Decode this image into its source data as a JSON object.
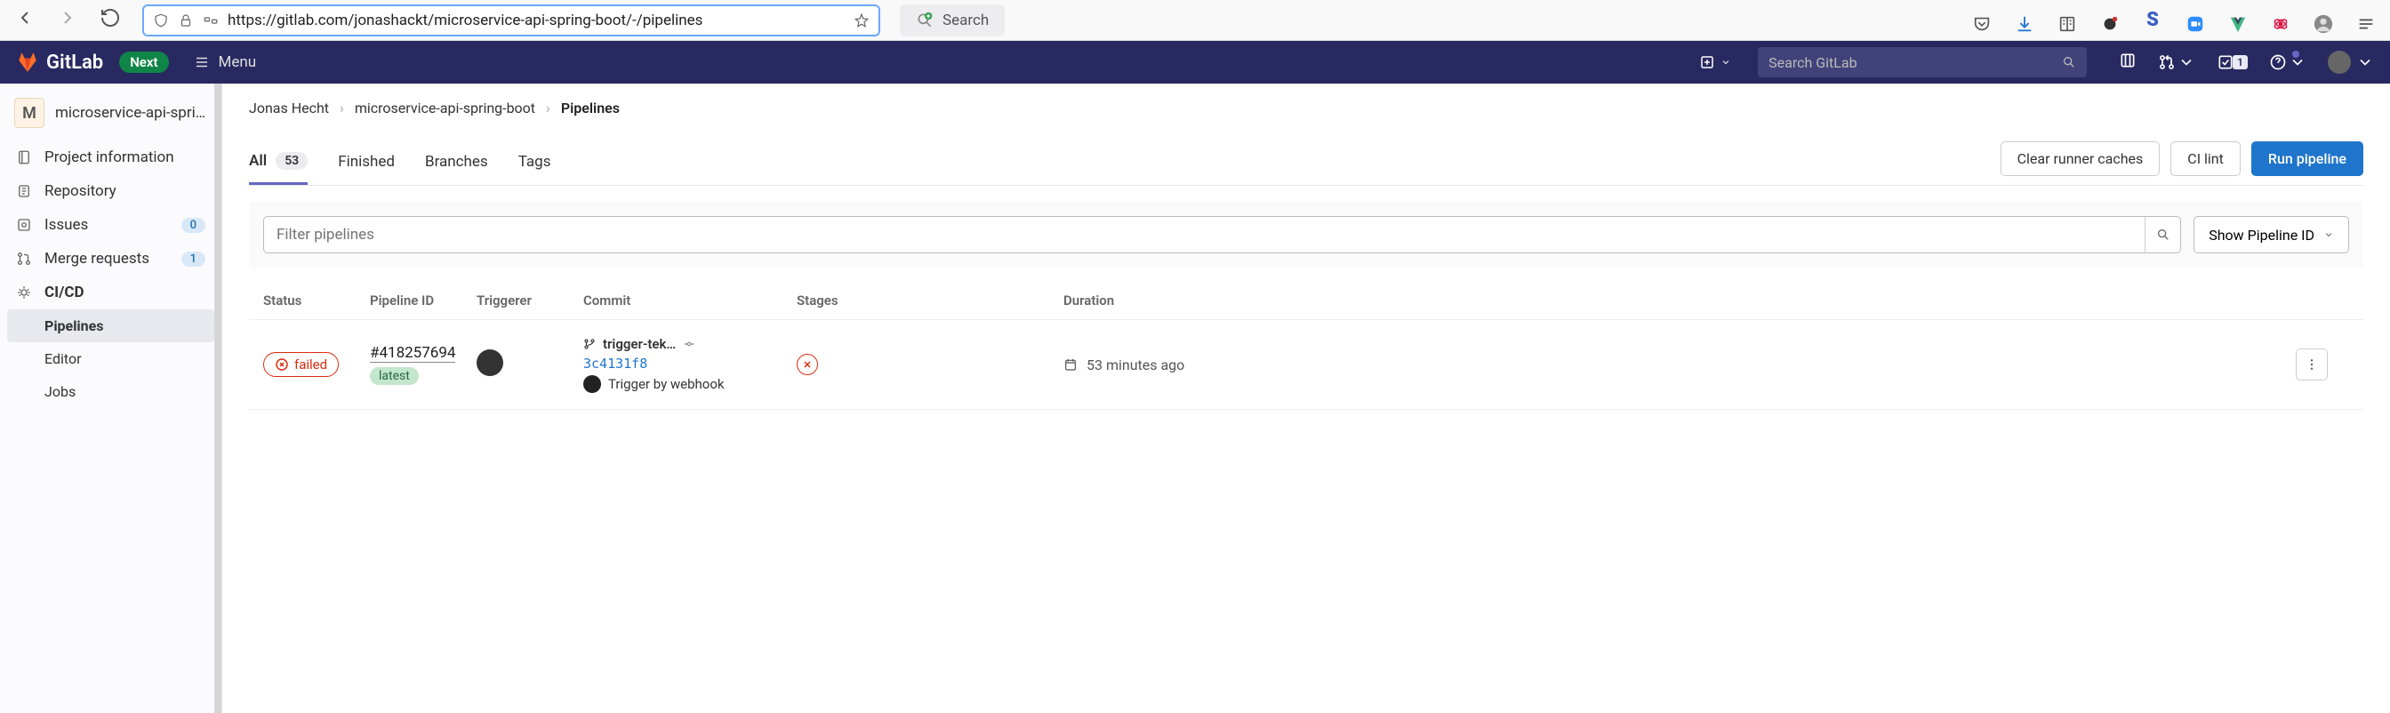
{
  "browser": {
    "url": "https://gitlab.com/jonashackt/microservice-api-spring-boot/-/pipelines",
    "search_label": "Search"
  },
  "nav": {
    "brand": "GitLab",
    "next_badge": "Next",
    "menu_label": "Menu",
    "search_placeholder": "Search GitLab",
    "todo_count": "1"
  },
  "sidebar": {
    "project_initial": "M",
    "project_name": "microservice-api-spri…",
    "items": [
      {
        "label": "Project information"
      },
      {
        "label": "Repository"
      },
      {
        "label": "Issues",
        "badge": "0"
      },
      {
        "label": "Merge requests",
        "badge": "1"
      },
      {
        "label": "CI/CD",
        "bold": true
      }
    ],
    "sub": {
      "pipelines": "Pipelines",
      "editor": "Editor",
      "jobs": "Jobs"
    }
  },
  "breadcrumbs": {
    "owner": "Jonas Hecht",
    "repo": "microservice-api-spring-boot",
    "current": "Pipelines"
  },
  "tabs": {
    "all": "All",
    "all_count": "53",
    "finished": "Finished",
    "branches": "Branches",
    "tags": "Tags"
  },
  "actions": {
    "clear_caches": "Clear runner caches",
    "ci_lint": "CI lint",
    "run_pipeline": "Run pipeline"
  },
  "filter": {
    "placeholder": "Filter pipelines",
    "show_id": "Show Pipeline ID"
  },
  "table": {
    "headers": {
      "status": "Status",
      "pipeline_id": "Pipeline ID",
      "triggerer": "Triggerer",
      "commit": "Commit",
      "stages": "Stages",
      "duration": "Duration"
    },
    "row": {
      "status": "failed",
      "pipeline_id": "#418257694",
      "badge": "latest",
      "branch": "trigger-tek…",
      "sha": "3c4131f8",
      "message": "Trigger by webhook",
      "duration": "53 minutes ago"
    }
  }
}
